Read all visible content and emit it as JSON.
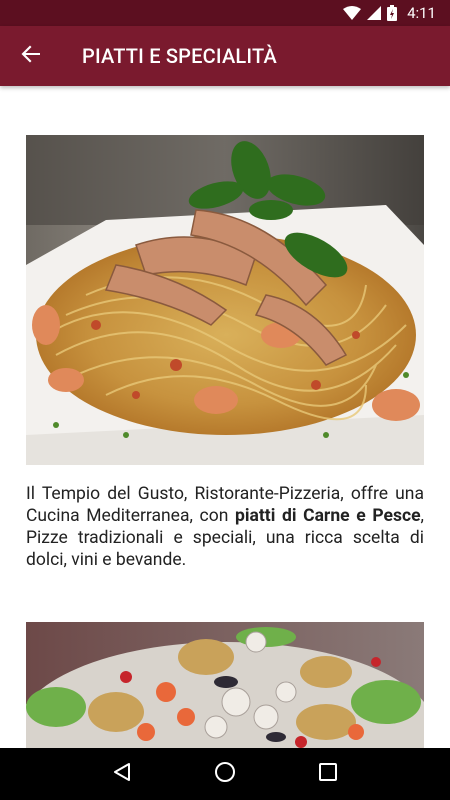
{
  "status_bar": {
    "time": "4:11",
    "icons": [
      "wifi-icon",
      "cell-signal-icon",
      "battery-charging-icon"
    ]
  },
  "app_bar": {
    "title": "PIATTI E SPECIALITÀ",
    "back_icon": "arrow-back-icon"
  },
  "content": {
    "image_1": "pasta-with-langoustines-photo",
    "description": {
      "part1": "Il Tempio del Gusto, Ristorante-Pizzeria, offre una Cucina Mediterranea, con ",
      "bold": "piatti di Carne e Pesce",
      "part2": ", Pizze tradizionali e speciali, una ricca scelta di dolci, vini e bevande."
    },
    "image_2": "seafood-platter-photo"
  },
  "nav_bar": {
    "buttons": [
      "back-triangle-icon",
      "home-circle-icon",
      "recents-square-icon"
    ]
  },
  "colors": {
    "status_bar": "#5c0f20",
    "app_bar": "#7a1a2e",
    "nav_bar": "#000000"
  }
}
